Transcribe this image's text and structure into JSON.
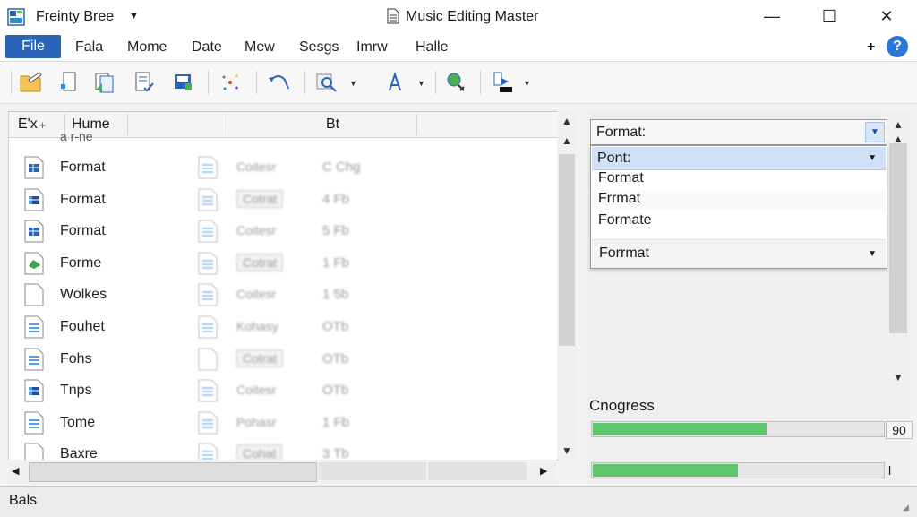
{
  "titlebar": {
    "app_name": "Freinty Bree",
    "window_title": "Music Editing Master",
    "minimize": "—",
    "maximize": "☐",
    "close": "✕"
  },
  "menubar": {
    "file": "File",
    "items": [
      "Fala",
      "Mome",
      "Date",
      "Mew",
      "Sesgs",
      "Imrw",
      "Halle"
    ],
    "plus": "+",
    "help": "?"
  },
  "list": {
    "headers": [
      "E'x",
      "Hume",
      "Bt"
    ],
    "partial_top_name": "a r-ne",
    "rows": [
      {
        "name": "Format",
        "type": "Coitesr",
        "size": "C Chg"
      },
      {
        "name": "Format",
        "type": "Cotrat",
        "size": "4 Fb"
      },
      {
        "name": "Format",
        "type": "Coitesr",
        "size": "5 Fb"
      },
      {
        "name": "Forme",
        "type": "Cotrat",
        "size": "1 Fb"
      },
      {
        "name": "Wolkes",
        "type": "Coitesr",
        "size": "1 5b"
      },
      {
        "name": "Fouhet",
        "type": "Kohasy",
        "size": "OTb"
      },
      {
        "name": "Fohs",
        "type": "Cotrat",
        "size": "OTb"
      },
      {
        "name": "Tnps",
        "type": "Coitesr",
        "size": "OTb"
      },
      {
        "name": "Tome",
        "type": "Pohasr",
        "size": "1 Fb"
      },
      {
        "name": "Baxre",
        "type": "Cohat",
        "size": "3 Tb"
      }
    ]
  },
  "format_panel": {
    "combo_label": "Format:",
    "dropdown": {
      "header": "Pont:",
      "items": [
        "Format",
        "Frrmat",
        "Formate"
      ],
      "last": "Forrmat"
    }
  },
  "progress": {
    "label": "Cnogress",
    "bar1": {
      "value": 0.6,
      "display": "90"
    },
    "bar2": {
      "value": 0.5,
      "display": "l"
    }
  },
  "statusbar": {
    "text": "Bals"
  },
  "colors": {
    "accent": "#2b63b6",
    "progress_fill": "#5fc66d",
    "selection": "#cfe0f7"
  }
}
